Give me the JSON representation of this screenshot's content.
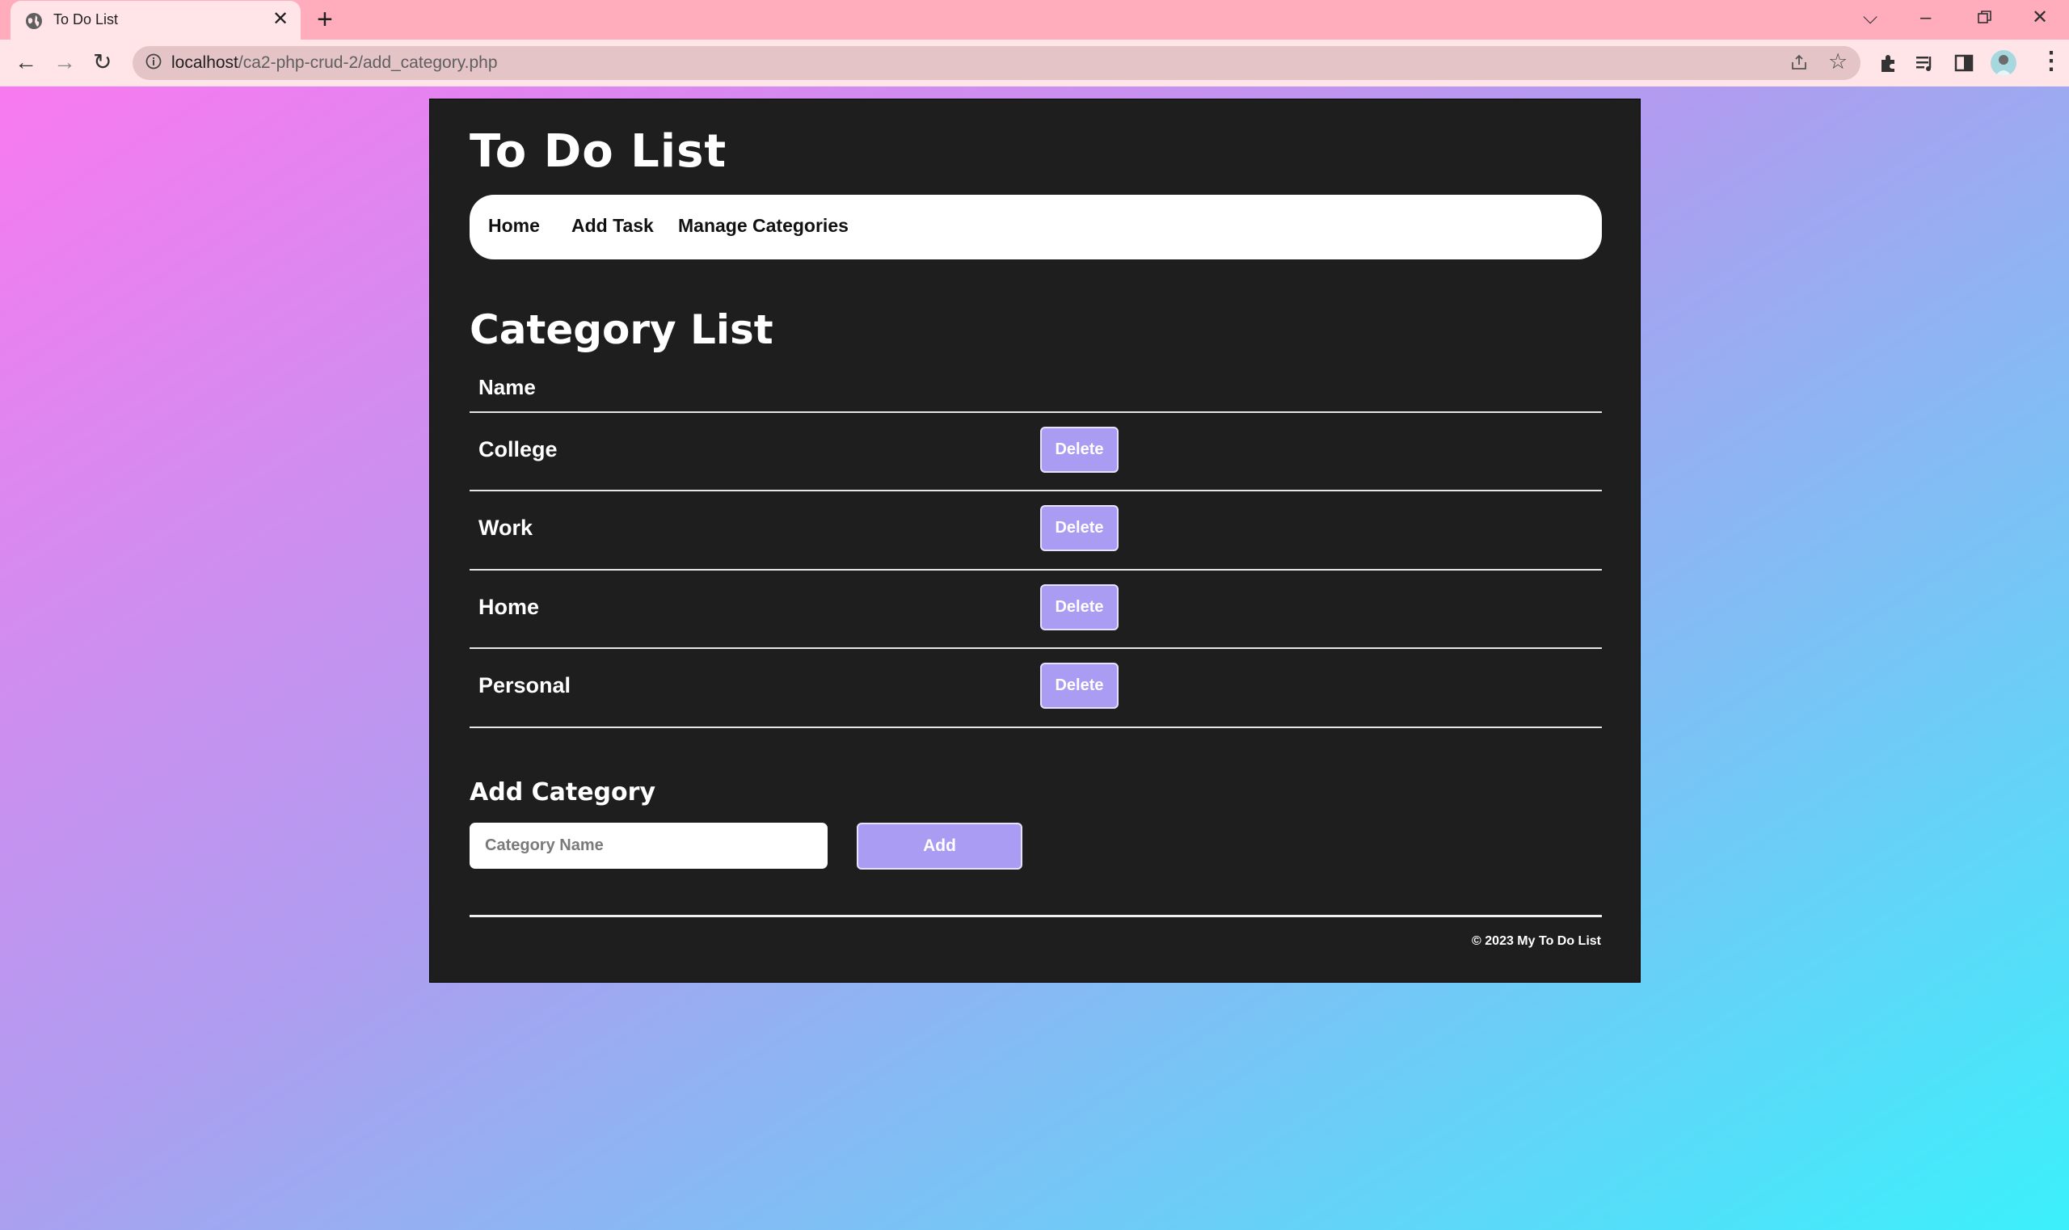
{
  "browser": {
    "tab_title": "To Do List",
    "url_host": "localhost",
    "url_path": "/ca2-php-crud-2/add_category.php"
  },
  "site": {
    "title": "To Do List",
    "nav": [
      "Home",
      "Add Task",
      "Manage Categories"
    ]
  },
  "category_list": {
    "heading": "Category List",
    "column_header": "Name",
    "rows": [
      {
        "name": "College",
        "action": "Delete"
      },
      {
        "name": "Work",
        "action": "Delete"
      },
      {
        "name": "Home",
        "action": "Delete"
      },
      {
        "name": "Personal",
        "action": "Delete"
      }
    ]
  },
  "add_category": {
    "heading": "Add Category",
    "input_placeholder": "Category Name",
    "input_value": "",
    "button_label": "Add"
  },
  "footer": {
    "text": "© 2023 My To Do List"
  },
  "colors": {
    "accent": "#aa9bf3",
    "card_background": "#1e1e1e",
    "gradient_start": "#f87af0",
    "gradient_end": "#3bf0fb"
  }
}
